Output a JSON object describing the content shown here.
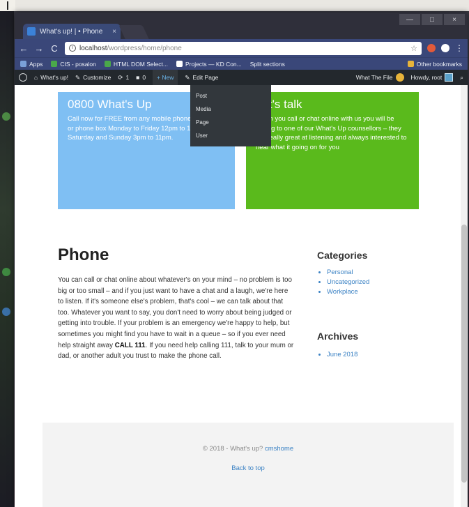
{
  "browser": {
    "tab_title": "What's up! | • Phone",
    "tab_close": "×",
    "window_buttons": [
      "—",
      "□",
      "×"
    ],
    "nav": {
      "back": "←",
      "forward": "→",
      "reload": "C"
    },
    "url_host": "localhost",
    "url_path": "/wordpress/home/phone",
    "menu": "⋮"
  },
  "bookmarks": {
    "items": [
      {
        "label": "Apps",
        "color": "#7aa0d8"
      },
      {
        "label": "CIS - posalon",
        "color": "#4aa84a"
      },
      {
        "label": "HTML DOM Select...",
        "color": "#4aa84a"
      },
      {
        "label": "Projects — KD Con...",
        "color": "#ffffff"
      },
      {
        "label": "Split sections",
        "color": "#3a4779"
      }
    ],
    "other": "Other bookmarks",
    "other_color": "#e8b43a"
  },
  "adminbar": {
    "site_name": "What's up!",
    "customize": "Customize",
    "updates": "1",
    "comments": "0",
    "new": "+ New",
    "edit_page": "Edit Page",
    "right_text": "What The File",
    "howdy": "Howdy, root",
    "search_icon": "⌕"
  },
  "dropdown": {
    "items": [
      "Post",
      "Media",
      "Page",
      "User"
    ]
  },
  "cards": {
    "blue": {
      "title": "0800 What's Up",
      "text": "Call now for FREE from any mobile phone, landline or phone box Monday to Friday 12pm to 11pm and Saturday and Sunday 3pm to 11pm."
    },
    "green": {
      "title": "Let's talk",
      "text": "When you call or chat online with us you will be talking to one of our What's Up counsellors – they are really great at listening and always interested to hear what it going on for you"
    }
  },
  "main": {
    "title": "Phone",
    "paragraph_1": "You can call or chat online about whatever's on your mind – no problem is too big or too small – and if you just want to have a chat and a laugh, we're here to listen. If it's someone else's problem, that's cool – we can talk about that too. Whatever you want to say, you don't need to worry about being judged or getting into trouble. If your problem is an emergency we're happy to help, but sometimes you might find you have to wait in a queue – so if you ever need help straight away ",
    "call_bold": "CALL 111",
    "paragraph_2": ". If you need help calling 111, talk to your mum or dad, or another adult you trust to make the phone call."
  },
  "sidebar": {
    "categories_title": "Categories",
    "categories": [
      "Personal",
      "Uncategorized",
      "Workplace"
    ],
    "archives_title": "Archives",
    "archives": [
      "June 2018"
    ]
  },
  "footer": {
    "copyright": "© 2018 - What's up? ",
    "credit_link": "cmshome",
    "back_to_top": "Back to top"
  }
}
